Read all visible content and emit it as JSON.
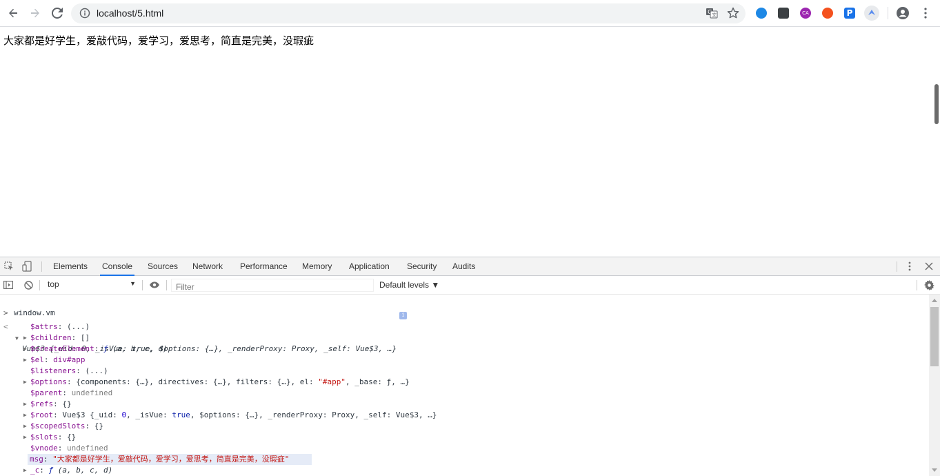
{
  "browser": {
    "url": "localhost/5.html",
    "extensions": [
      {
        "name": "globe-extension-icon",
        "color": "#1e88e5"
      },
      {
        "name": "dark-square-extension-icon",
        "color": "#3c4043"
      },
      {
        "name": "ca-extension-icon",
        "color": "#9c27b0"
      },
      {
        "name": "orange-extension-icon",
        "color": "#f4511e"
      },
      {
        "name": "p-extension-icon",
        "color": "#1a73e8"
      },
      {
        "name": "bird-extension-icon",
        "color": "#5b8def"
      }
    ]
  },
  "page": {
    "text": "大家都是好学生，爱敲代码，爱学习，爱思考，简直是完美，没瑕疵"
  },
  "devtools": {
    "tabs": [
      "Elements",
      "Console",
      "Sources",
      "Network",
      "Performance",
      "Memory",
      "Application",
      "Security",
      "Audits"
    ],
    "active_tab": "Console",
    "context": "top",
    "filter_placeholder": "Filter",
    "levels": "Default levels ▼"
  },
  "console": {
    "input": "window.vm",
    "object_header": "Vue$3 {_uid: 0, _isVue: true, $options: {…}, _renderProxy: Proxy, _self: Vue$3, …}",
    "props": [
      {
        "key": "$attrs",
        "value": "(...)",
        "expandable": false,
        "style": "txt"
      },
      {
        "key": "$children",
        "value": "[]",
        "expandable": true,
        "style": "txt"
      },
      {
        "key": "$createElement",
        "value": "ƒ (a, b, c, d)",
        "expandable": true,
        "style": "fn"
      },
      {
        "key": "$el",
        "value": "div#app",
        "expandable": true,
        "style": "el"
      },
      {
        "key": "$listeners",
        "value": "(...)",
        "expandable": false,
        "style": "txt"
      },
      {
        "key": "$options",
        "value": "{components: {…}, directives: {…}, filters: {…}, el: \"#app\", _base: ƒ, …}",
        "expandable": true,
        "style": "obj"
      },
      {
        "key": "$parent",
        "value": "undefined",
        "expandable": false,
        "style": "und"
      },
      {
        "key": "$refs",
        "value": "{}",
        "expandable": true,
        "style": "txt"
      },
      {
        "key": "$root",
        "value": "Vue$3 {_uid: 0, _isVue: true, $options: {…}, _renderProxy: Proxy, _self: Vue$3, …}",
        "expandable": true,
        "style": "txt"
      },
      {
        "key": "$scopedSlots",
        "value": "{}",
        "expandable": true,
        "style": "txt"
      },
      {
        "key": "$slots",
        "value": "{}",
        "expandable": true,
        "style": "txt"
      },
      {
        "key": "$vnode",
        "value": "undefined",
        "expandable": false,
        "style": "und"
      },
      {
        "key": "msg",
        "value": "\"大家都是好学生，爱敲代码，爱学习，爱思考，简直是完美，没瑕疵\"",
        "expandable": false,
        "style": "str"
      },
      {
        "key": "_c",
        "value": "ƒ (a, b, c, d)",
        "expandable": true,
        "style": "fn"
      }
    ]
  }
}
